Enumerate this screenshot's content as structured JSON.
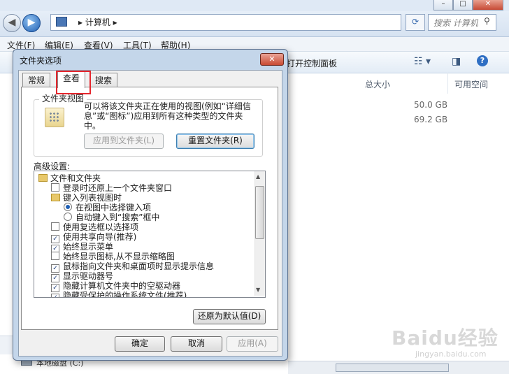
{
  "explorer": {
    "address": "▸ 计算机 ▸",
    "search_placeholder": "搜索 计算机",
    "menu": [
      "文件(F)",
      "编辑(E)",
      "查看(V)",
      "工具(T)",
      "帮助(H)"
    ],
    "toolbar_text": "打开控制面板",
    "columns": {
      "total_size": "总大小",
      "free_space": "可用空间"
    },
    "sizes": [
      "50.0 GB",
      "69.2 GB"
    ],
    "disk_label": "本地磁盘 (C:)",
    "watermark": "Baidu经验",
    "watermark_sub": "jingyan.baidu.com"
  },
  "dialog": {
    "title": "文件夹选项",
    "close_label": "✕",
    "tabs": [
      "常规",
      "查看",
      "搜索"
    ],
    "active_tab": "查看",
    "group_title": "文件夹视图",
    "description": "可以将该文件夹正在使用的视图(例如“详细信息”或“图标”)应用到所有这种类型的文件夹中。",
    "apply_button": "应用到文件夹(L)",
    "reset_button": "重置文件夹(R)",
    "advanced_label": "高级设置:",
    "tree": [
      {
        "type": "folder",
        "label": "文件和文件夹",
        "indent": 0
      },
      {
        "type": "checkbox",
        "label": "登录时还原上一个文件夹窗口",
        "checked": false,
        "indent": 1
      },
      {
        "type": "folder",
        "label": "键入列表视图时",
        "indent": 1
      },
      {
        "type": "radio",
        "label": "在视图中选择键入项",
        "checked": true,
        "indent": 2
      },
      {
        "type": "radio",
        "label": "自动键入到“搜索”框中",
        "checked": false,
        "indent": 2
      },
      {
        "type": "checkbox",
        "label": "使用复选框以选择项",
        "checked": false,
        "indent": 1
      },
      {
        "type": "checkbox",
        "label": "使用共享向导(推荐)",
        "checked": true,
        "indent": 1
      },
      {
        "type": "checkbox",
        "label": "始终显示菜单",
        "checked": true,
        "indent": 1
      },
      {
        "type": "checkbox",
        "label": "始终显示图标,从不显示缩略图",
        "checked": false,
        "indent": 1
      },
      {
        "type": "checkbox",
        "label": "鼠标指向文件夹和桌面项时显示提示信息",
        "checked": true,
        "indent": 1
      },
      {
        "type": "checkbox",
        "label": "显示驱动器号",
        "checked": true,
        "indent": 1
      },
      {
        "type": "checkbox",
        "label": "隐藏计算机文件夹中的空驱动器",
        "checked": true,
        "indent": 1
      },
      {
        "type": "checkbox",
        "label": "隐藏受保护的操作系统文件(推荐)",
        "checked": true,
        "indent": 1
      }
    ],
    "restore_defaults": "还原为默认值(D)",
    "ok": "确定",
    "cancel": "取消",
    "apply": "应用(A)"
  }
}
